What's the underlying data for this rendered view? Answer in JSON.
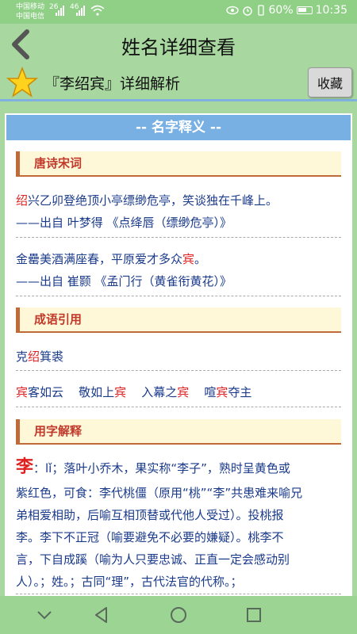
{
  "status": {
    "carrier1": "中国移动",
    "carrier2": "中国电信",
    "signal1": "26",
    "signal2": "46",
    "battery": "60%",
    "time": "10:35"
  },
  "header": {
    "title": "姓名详细查看"
  },
  "subheader": {
    "title": "『李绍宾』详细解析",
    "favorite_label": "收藏"
  },
  "content": {
    "section_title": "-- 名字释义 --",
    "poetry": {
      "heading": "唐诗宋词",
      "items": [
        {
          "hl": "绍",
          "text": "兴乙卯登绝顶小亭缥缈危亭，笑谈独在千峰上。",
          "source": "——出自 叶梦得 《点绛唇（缥缈危亭）》"
        },
        {
          "pre": "金罍美酒满座春，平原爱才多众",
          "hl": "宾",
          "post": "。",
          "source": "——出自 崔颢 《孟门行（黄雀衔黄花）》"
        }
      ]
    },
    "idioms": {
      "heading": "成语引用",
      "row1": {
        "pre": "克",
        "hl": "绍",
        "post": "箕裘"
      },
      "row2": [
        {
          "hl": "宾",
          "post": "客如云"
        },
        {
          "pre": "敬如上",
          "hl": "宾"
        },
        {
          "pre": "入幕之",
          "hl": "宾"
        },
        {
          "pre": "喧",
          "hl": "宾",
          "post": "夺主"
        }
      ]
    },
    "chars": {
      "heading": "用字解释",
      "char": "李",
      "lines": [
        "：lǐ；落叶小乔木，果实称“李子”，熟时呈黄色或",
        "紫红色，可食：李代桃僵（原用“桃”“李”共患难来喻兄",
        "弟相爱相助，后喻互相顶替或代他人受过）。投桃报",
        "李。李下不正冠（喻要避免不必要的嫌疑）。桃李不",
        "言，下自成蹊（喻为人只要忠诚、正直一定会感动别",
        "人）。；姓。；古同“理”，古代法官的代称。；"
      ]
    }
  },
  "colors": {
    "green_bg": "#a8d8a0",
    "blue_header": "#79b0e3",
    "highlight_red": "#e02020",
    "text_blue": "#1a3a8a"
  }
}
